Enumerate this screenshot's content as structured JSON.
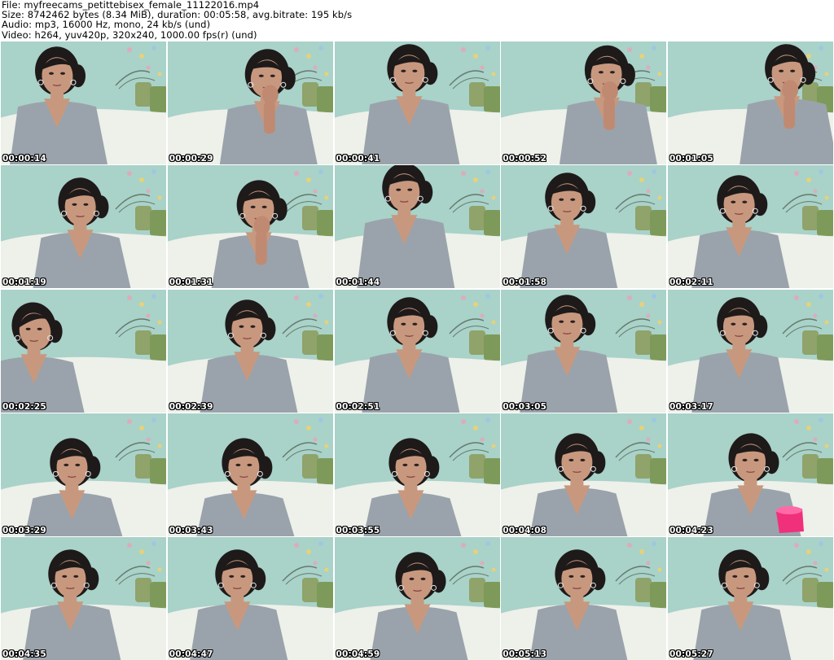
{
  "header": {
    "file_line": "File: myfreecams_petittebisex_female_11122016.mp4",
    "size_line": "Size: 8742462 bytes (8.34 MiB), duration: 00:05:58, avg.bitrate: 195 kb/s",
    "audio_line": "Audio: mp3, 16000 Hz, mono, 24 kb/s (und)",
    "video_line": "Video: h264, yuv420p, 320x240, 1000.00 fps(r) (und)"
  },
  "thumbnails": [
    {
      "timestamp": "00:00:14"
    },
    {
      "timestamp": "00:00:29"
    },
    {
      "timestamp": "00:00:41"
    },
    {
      "timestamp": "00:00:52"
    },
    {
      "timestamp": "00:01:05"
    },
    {
      "timestamp": "00:01:19"
    },
    {
      "timestamp": "00:01:31"
    },
    {
      "timestamp": "00:01:44"
    },
    {
      "timestamp": "00:01:58"
    },
    {
      "timestamp": "00:02:11"
    },
    {
      "timestamp": "00:02:25"
    },
    {
      "timestamp": "00:02:39"
    },
    {
      "timestamp": "00:02:51"
    },
    {
      "timestamp": "00:03:05"
    },
    {
      "timestamp": "00:03:17"
    },
    {
      "timestamp": "00:03:29"
    },
    {
      "timestamp": "00:03:43"
    },
    {
      "timestamp": "00:03:55"
    },
    {
      "timestamp": "00:04:08"
    },
    {
      "timestamp": "00:04:23"
    },
    {
      "timestamp": "00:04:35"
    },
    {
      "timestamp": "00:04:47"
    },
    {
      "timestamp": "00:04:59"
    },
    {
      "timestamp": "00:05:13"
    },
    {
      "timestamp": "00:05:27"
    }
  ],
  "colors": {
    "wall": "#a9d2c9",
    "bedding": "#eef0ea",
    "shirt": "#9aa3ab",
    "skin": "#c8987e",
    "hair": "#1e1a1a",
    "pillow": "#8fa36a",
    "cup": "#f0307a"
  }
}
